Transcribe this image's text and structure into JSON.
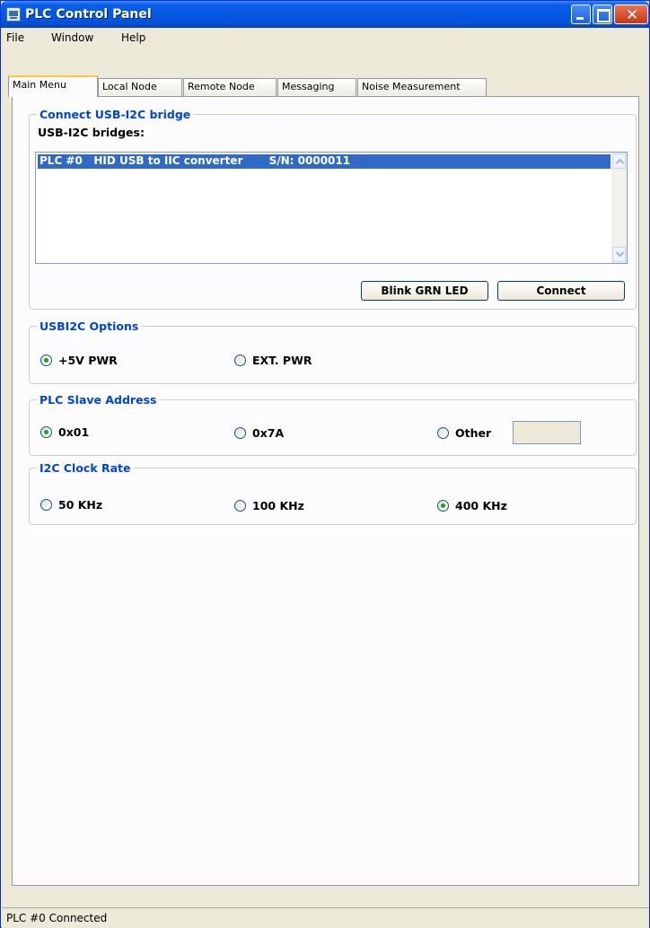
{
  "window": {
    "title": "PLC Control Panel"
  },
  "menu": {
    "file": "File",
    "window": "Window",
    "help": "Help"
  },
  "tabs": [
    "Main Menu",
    "Local Node",
    "Remote Node",
    "Messaging",
    "Noise Measurement"
  ],
  "connect_group": {
    "title": "Connect USB-I2C bridge",
    "list_label": "USB-I2C bridges:",
    "items": [
      "PLC #0   HID USB to IIC converter       S/N: 0000011"
    ],
    "blink_button": "Blink GRN LED",
    "connect_button": "Connect"
  },
  "usbi2c_options": {
    "title": "USBI2C Options",
    "options": [
      {
        "label": "+5V PWR",
        "selected": true
      },
      {
        "label": "EXT. PWR",
        "selected": false
      }
    ]
  },
  "slave_address": {
    "title": "PLC Slave Address",
    "options": [
      {
        "label": "0x01",
        "selected": true
      },
      {
        "label": "0x7A",
        "selected": false
      },
      {
        "label": "Other",
        "selected": false
      }
    ],
    "other_value": ""
  },
  "clock_rate": {
    "title": "I2C Clock Rate",
    "options": [
      {
        "label": "50 KHz",
        "selected": false
      },
      {
        "label": "100 KHz",
        "selected": false
      },
      {
        "label": "400 KHz",
        "selected": true
      }
    ]
  },
  "status": {
    "text": "PLC #0 Connected"
  }
}
